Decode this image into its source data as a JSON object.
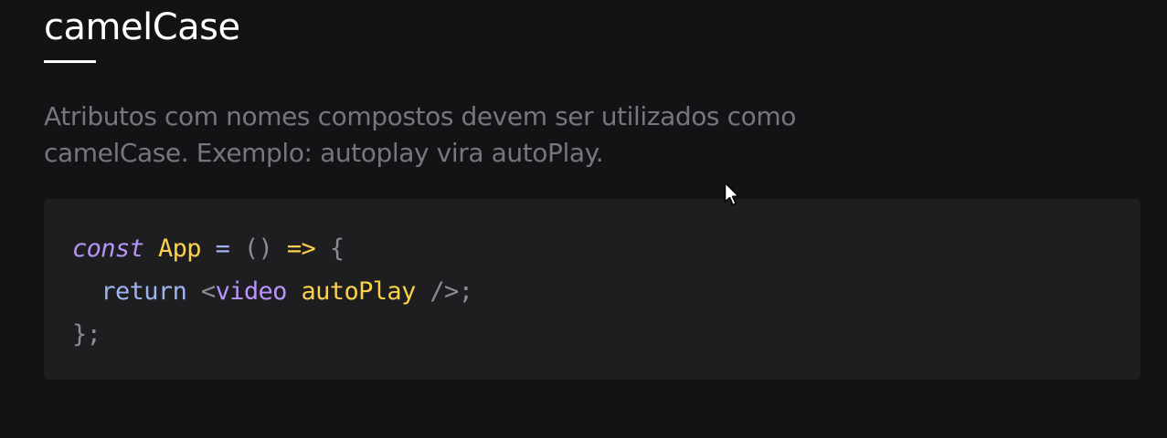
{
  "section": {
    "title": "camelCase",
    "description": "Atributos com nomes compostos devem ser utilizados como camelCase. Exemplo: autoplay vira autoPlay."
  },
  "code": {
    "line1": {
      "keyword": "const",
      "name": "App",
      "equals": "=",
      "parens": "()",
      "arrow": "=>",
      "brace_open": "{"
    },
    "line2": {
      "keyword": "return",
      "tag_open": "<",
      "tag_name": "video",
      "attribute": "autoPlay",
      "tag_close": "/>",
      "semicolon": ";"
    },
    "line3": {
      "brace_close": "}",
      "semicolon": ";"
    }
  },
  "colors": {
    "background": "#131316",
    "code_background": "#1e1e21",
    "keyword_purple": "#b794f6",
    "identifier_yellow": "#fbd14b",
    "operator_blue": "#9fb3f0"
  },
  "icons": {
    "cursor": "mouse-pointer-icon"
  }
}
